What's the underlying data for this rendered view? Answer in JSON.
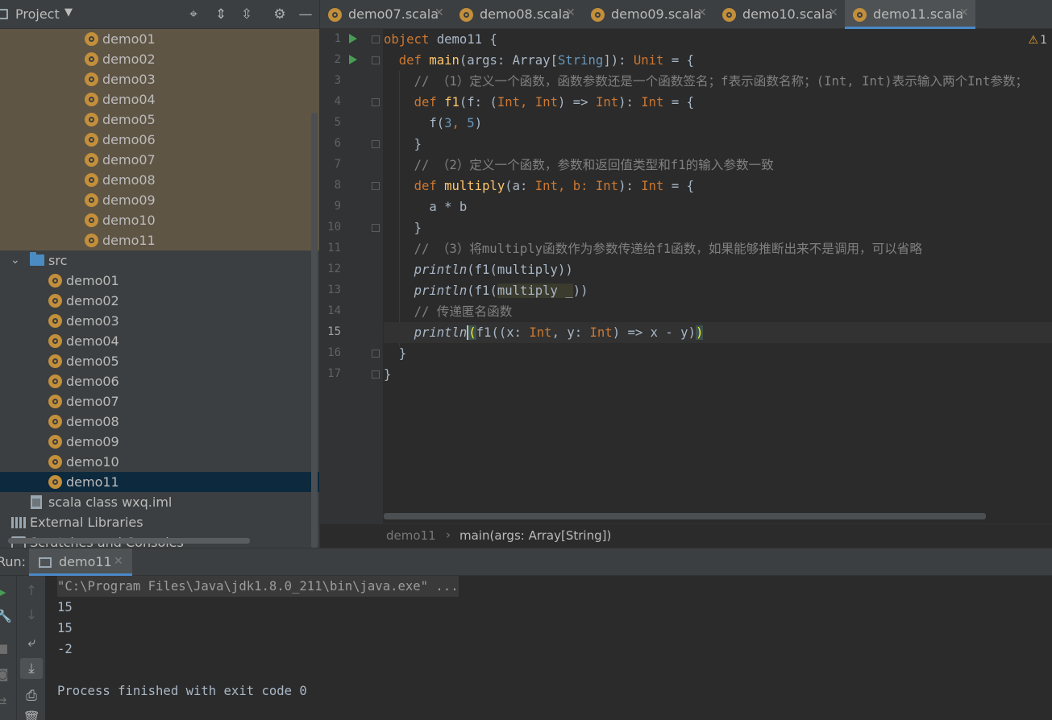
{
  "project_panel": {
    "title": "Project",
    "tree": {
      "module_objects": [
        "demo01",
        "demo02",
        "demo03",
        "demo04",
        "demo05",
        "demo06",
        "demo07",
        "demo08",
        "demo09",
        "demo10",
        "demo11"
      ],
      "src_folder": "src",
      "src_objects": [
        "demo01",
        "demo02",
        "demo03",
        "demo04",
        "demo05",
        "demo06",
        "demo07",
        "demo08",
        "demo09",
        "demo10",
        "demo11"
      ],
      "iml_file": "scala class wxq.iml",
      "external_libraries": "External Libraries",
      "scratches": "Scratches and Consoles"
    }
  },
  "tabs": [
    {
      "label": "demo07.scala",
      "active": false
    },
    {
      "label": "demo08.scala",
      "active": false
    },
    {
      "label": "demo09.scala",
      "active": false
    },
    {
      "label": "demo10.scala",
      "active": false
    },
    {
      "label": "demo11.scala",
      "active": true
    }
  ],
  "editor": {
    "current_line": 15,
    "warning_count": "1",
    "line_numbers": [
      "1",
      "2",
      "3",
      "4",
      "5",
      "6",
      "7",
      "8",
      "9",
      "10",
      "11",
      "12",
      "13",
      "14",
      "15",
      "16",
      "17"
    ],
    "code": {
      "l1_kw": "object",
      "l1_rest": " demo11 {",
      "l2_kw": "def",
      "l2_fn": "main",
      "l2_a": "(args: Array[",
      "l2_type": "String",
      "l2_b": "]): ",
      "l2_kw2": "Unit",
      "l2_c": " = {",
      "l3": "// （1）定义一个函数，函数参数还是一个函数签名；f表示函数名称；(Int, Int)表示输入两个Int参数；",
      "l4_kw": "def",
      "l4_fn": "f1",
      "l4_a": "(f: (",
      "l4_t1": "Int",
      "l4_b": ", ",
      "l4_t2": "Int",
      "l4_c": ") => ",
      "l4_t3": "Int",
      "l4_d": "): ",
      "l4_t4": "Int",
      "l4_e": " = {",
      "l5_a": "f(",
      "l5_n1": "3",
      "l5_b": ", ",
      "l5_n2": "5",
      "l5_c": ")",
      "l6": "}",
      "l7": "// （2）定义一个函数，参数和返回值类型和f1的输入参数一致",
      "l8_kw": "def",
      "l8_fn": "multiply",
      "l8_a": "(a: ",
      "l8_t1": "Int",
      "l8_b": ", b: ",
      "l8_t2": "Int",
      "l8_c": "): ",
      "l8_t3": "Int",
      "l8_d": " = {",
      "l9": "a * b",
      "l10": "}",
      "l11": "// （3）将multiply函数作为参数传递给f1函数，如果能够推断出来不是调用，可以省略",
      "l12_fn": "println",
      "l12_a": "(f1(multiply))",
      "l13_fn": "println",
      "l13_a": "(f1(",
      "l13_hl": "multiply _",
      "l13_b": "))",
      "l14": "// 传递匿名函数",
      "l15_fn": "println",
      "l15_a": "(",
      "l15_b": "f1((x: ",
      "l15_t1": "Int",
      "l15_c": ", y: ",
      "l15_t2": "Int",
      "l15_d": ") => x - y)",
      "l15_e": ")",
      "l16": "}",
      "l17": "}"
    }
  },
  "breadcrumbs": {
    "object": "demo11",
    "separator": "›",
    "method": "main(args: Array[String])"
  },
  "run_panel": {
    "label": "Run:",
    "tab_label": "demo11",
    "console_lines": [
      "\"C:\\Program Files\\Java\\jdk1.8.0_211\\bin\\java.exe\" ...",
      "15",
      "15",
      "-2",
      "",
      "Process finished with exit code 0"
    ]
  },
  "colors": {
    "keyword": "#cc7832",
    "function": "#ffc66d",
    "comment": "#808080",
    "number": "#6897bb",
    "object_icon": "#c38f3a",
    "run_marker": "#499c54"
  }
}
